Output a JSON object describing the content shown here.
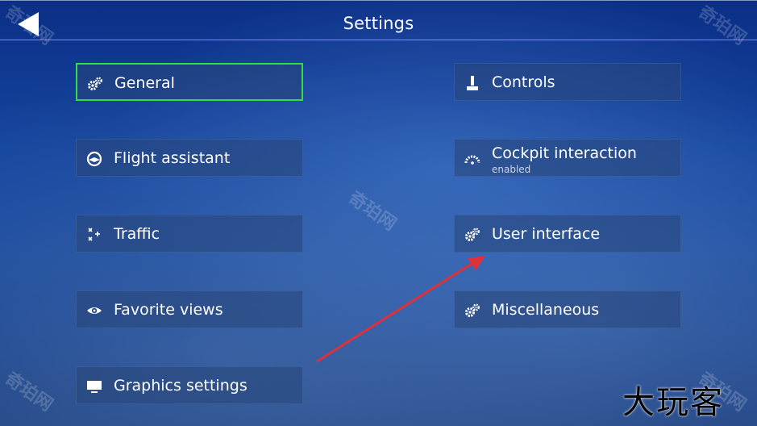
{
  "header": {
    "title": "Settings",
    "back_icon": "back-arrow-icon"
  },
  "menu": {
    "general": {
      "label": "General",
      "icon": "gears-icon",
      "selected": true
    },
    "flight_assistant": {
      "label": "Flight assistant",
      "icon": "assistant-icon"
    },
    "traffic": {
      "label": "Traffic",
      "icon": "traffic-planes-icon"
    },
    "favorite_views": {
      "label": "Favorite views",
      "icon": "eye-icon"
    },
    "graphics_settings": {
      "label": "Graphics settings",
      "icon": "monitor-icon"
    },
    "controls": {
      "label": "Controls",
      "icon": "joystick-icon"
    },
    "cockpit_interaction": {
      "label": "Cockpit interaction",
      "sub": "enabled",
      "icon": "gauge-icon"
    },
    "user_interface": {
      "label": "User interface",
      "icon": "gears-icon"
    },
    "miscellaneous": {
      "label": "Miscellaneous",
      "icon": "gears-icon"
    }
  },
  "watermarks": {
    "site": "奇珀网",
    "brand": "大玩客"
  },
  "colors": {
    "selected_border": "#33dd44",
    "annotation_arrow": "#e0303a"
  }
}
